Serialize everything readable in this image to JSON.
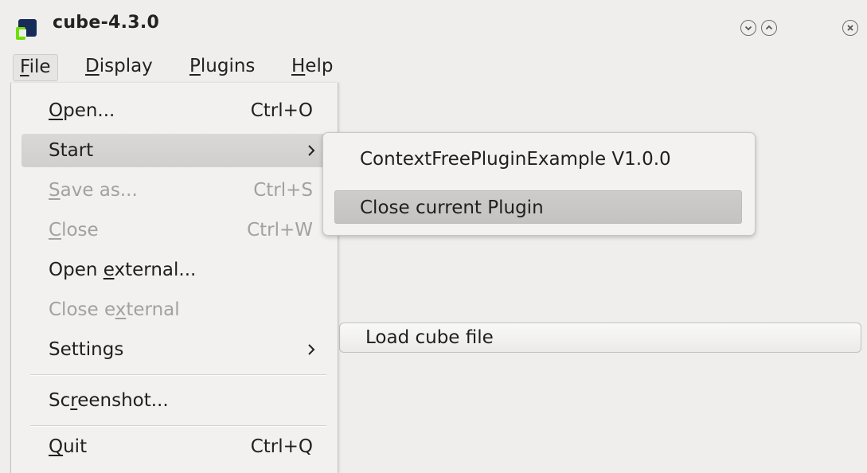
{
  "window": {
    "title": "cube-4.3.0",
    "icon": "cube-app-icon",
    "buttons": [
      "minimize-icon",
      "maximize-icon",
      "close-icon"
    ]
  },
  "menubar": {
    "items": [
      {
        "mnemonic": "F",
        "rest": "ile"
      },
      {
        "mnemonic": "D",
        "rest": "isplay"
      },
      {
        "mnemonic": "P",
        "rest": "lugins"
      },
      {
        "mnemonic": "H",
        "rest": "elp"
      }
    ]
  },
  "file_menu": {
    "open": {
      "pre": "",
      "mnemonic": "O",
      "post": "pen...",
      "shortcut": "Ctrl+O"
    },
    "start": {
      "label": "Start"
    },
    "save_as": {
      "pre": "",
      "mnemonic": "S",
      "post": "ave as...",
      "shortcut": "Ctrl+S",
      "disabled": true
    },
    "close": {
      "pre": "",
      "mnemonic": "C",
      "post": "lose",
      "shortcut": "Ctrl+W",
      "disabled": true
    },
    "open_external": {
      "pre": "Open ",
      "mnemonic": "e",
      "post": "xternal..."
    },
    "close_external": {
      "pre": "Close e",
      "mnemonic": "x",
      "post": "ternal",
      "disabled": true
    },
    "settings": {
      "label": "Settings"
    },
    "screenshot": {
      "pre": "Sc",
      "mnemonic": "r",
      "post": "eenshot..."
    },
    "quit": {
      "pre": "",
      "mnemonic": "Q",
      "post": "uit",
      "shortcut": "Ctrl+Q"
    }
  },
  "start_submenu": {
    "items": [
      {
        "label": "ContextFreePluginExample V1.0.0"
      },
      {
        "label": "Close current Plugin"
      }
    ]
  },
  "main": {
    "load_button": "Load cube file"
  }
}
